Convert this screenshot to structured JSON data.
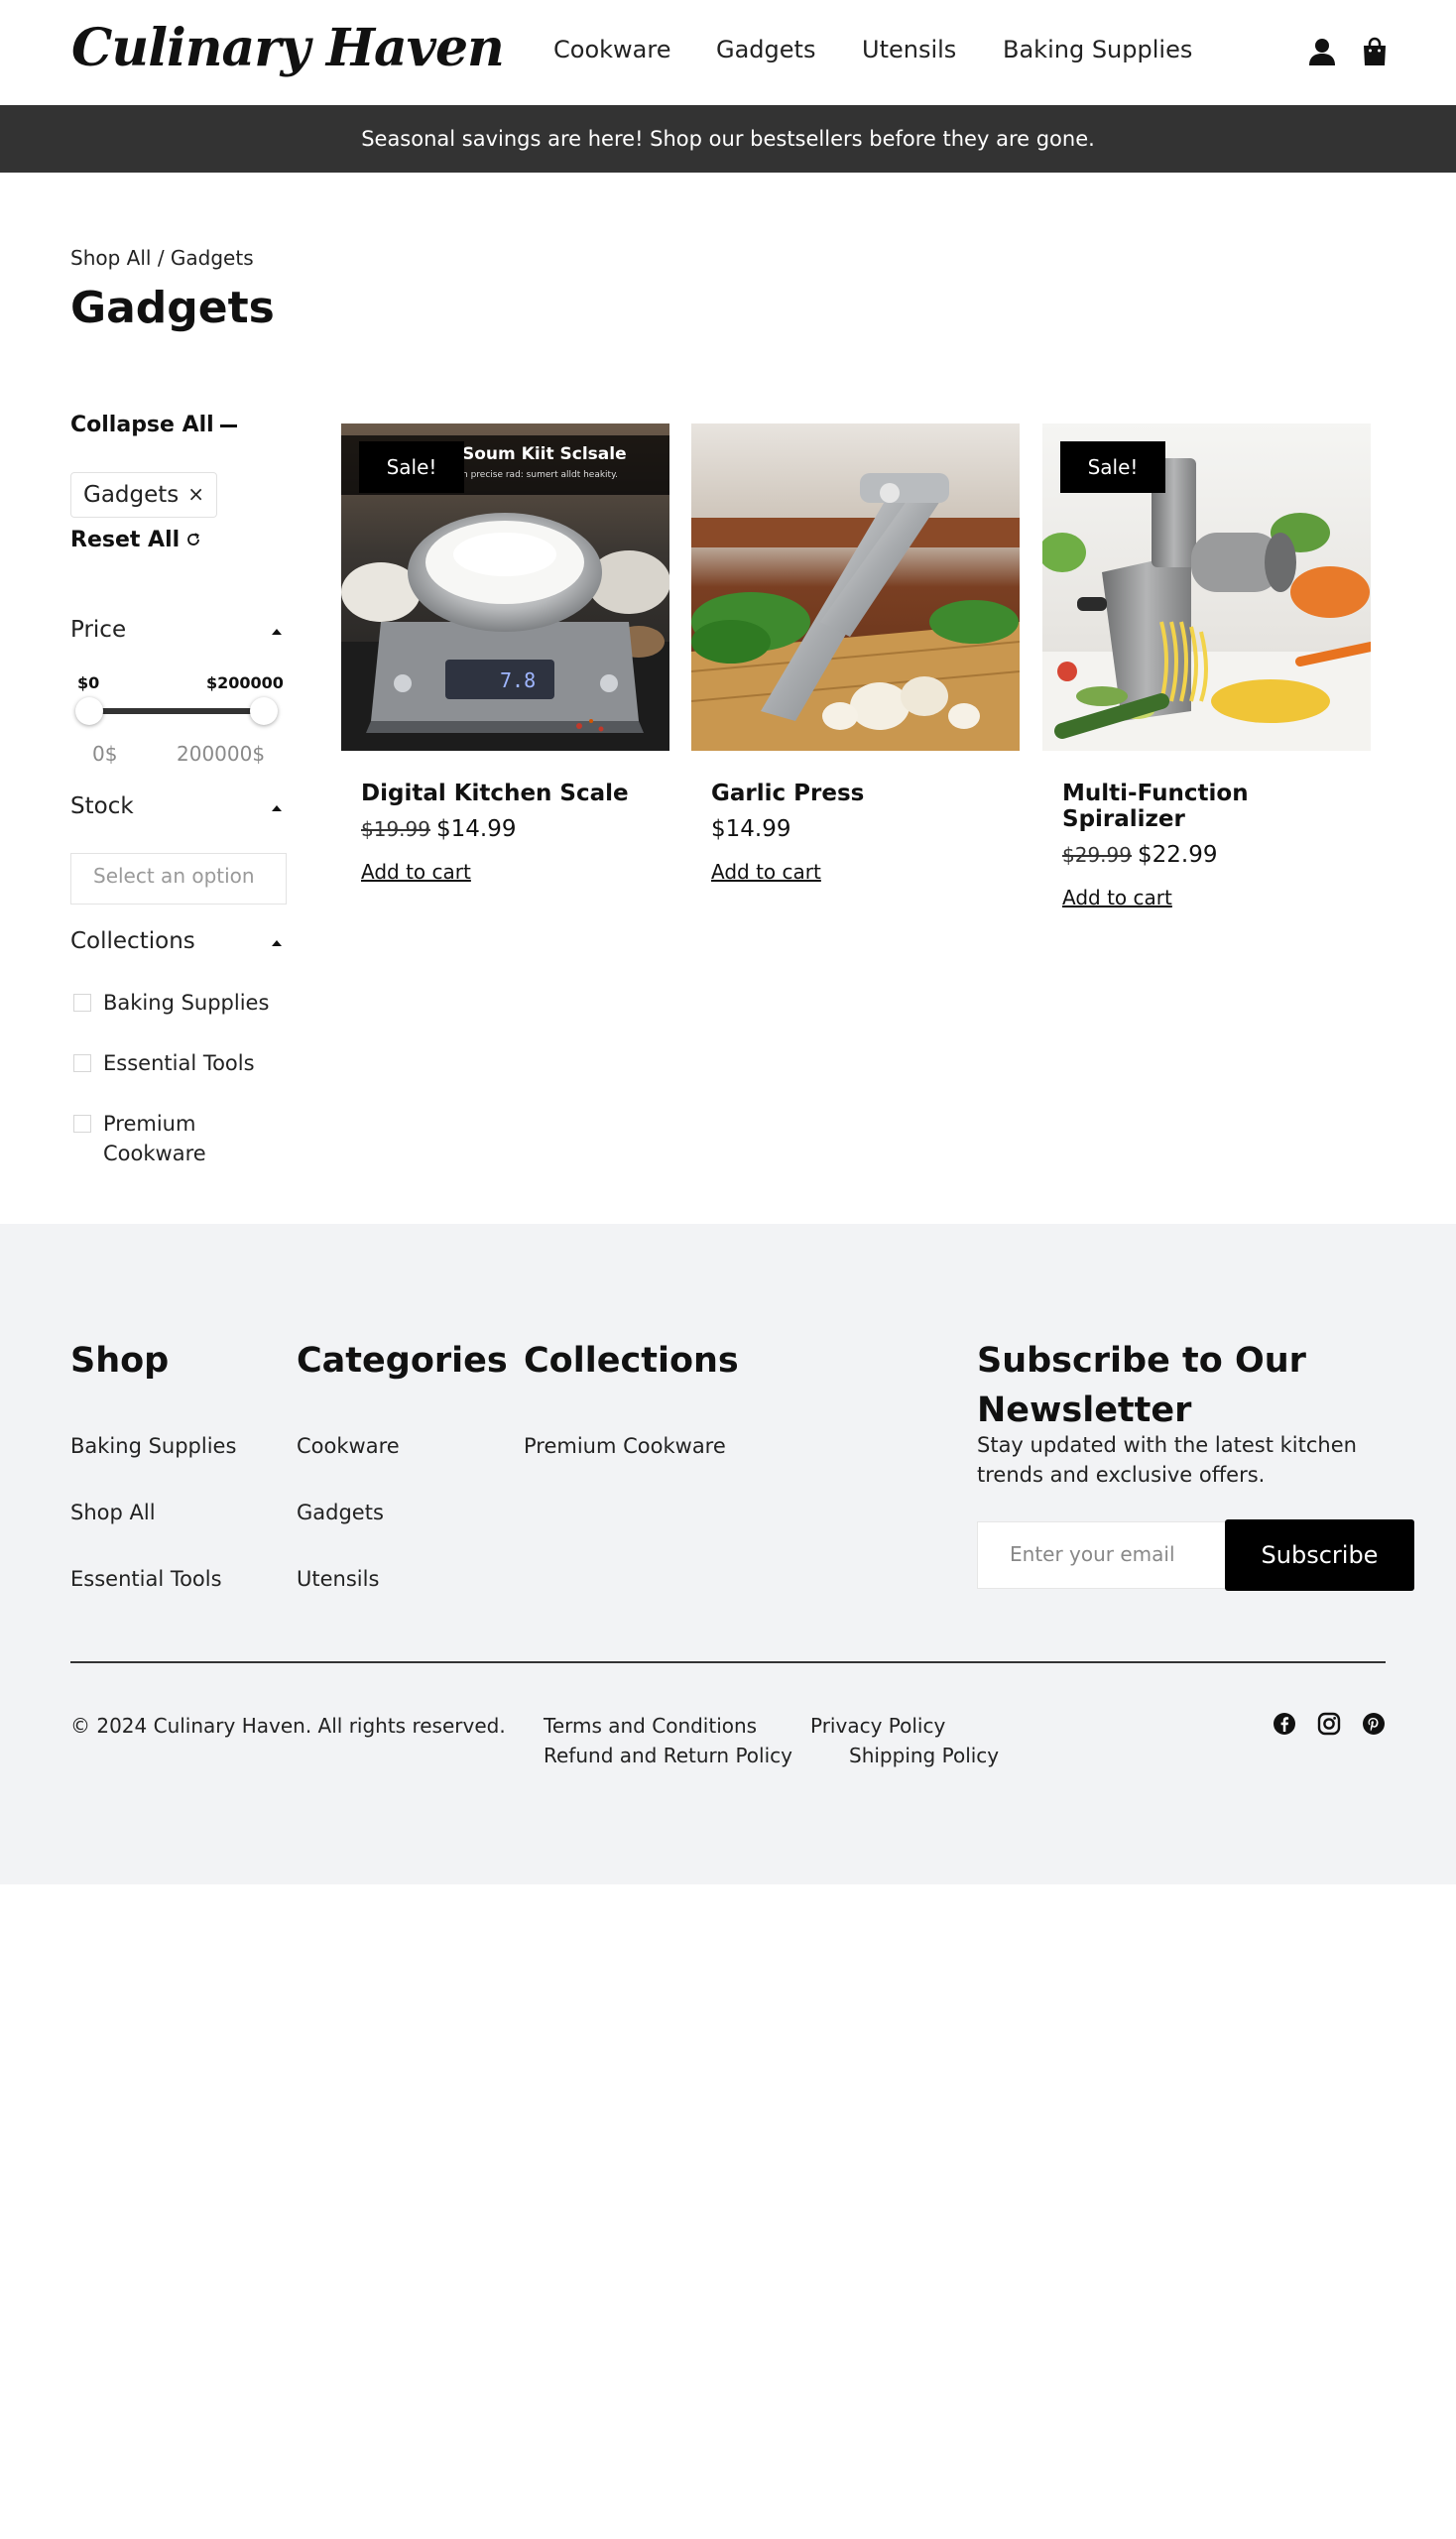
{
  "header": {
    "logo": "Culinary Haven",
    "nav": [
      "Cookware",
      "Gadgets",
      "Utensils",
      "Baking Supplies"
    ],
    "icons": [
      "account-icon",
      "shopping-bag-icon"
    ]
  },
  "announcement": "Seasonal savings are here! Shop our bestsellers before they are gone.",
  "breadcrumb": "Shop All / Gadgets",
  "page_title": "Gadgets",
  "filters": {
    "collapse_all": "Collapse All",
    "active_chip": "Gadgets",
    "chip_remove": "×",
    "reset_all": "Reset All",
    "price": {
      "title": "Price",
      "min_label": "$0",
      "max_label": "$200000",
      "range_min": "0$",
      "range_max": "200000$",
      "selected_min_fraction": 0,
      "selected_max_fraction": 1
    },
    "stock": {
      "title": "Stock",
      "placeholder": "Select an option"
    },
    "collections": {
      "title": "Collections",
      "options": [
        "Baking Supplies",
        "Essential Tools",
        "Premium Cookware"
      ]
    }
  },
  "products": [
    {
      "name": "Digital Kitchen Scale",
      "old_price": "$19.99",
      "price": "$14.99",
      "badge": "Sale!",
      "cta": "Add to cart",
      "image_text": "Soum Kiit Sclsale",
      "image_subtext": "n precise rad: sumert alldt heakity.",
      "scale_readout": "7.8"
    },
    {
      "name": "Garlic Press",
      "old_price": "",
      "price": "$14.99",
      "badge": "",
      "cta": "Add to cart"
    },
    {
      "name": "Multi-Function Spiralizer",
      "old_price": "$29.99",
      "price": "$22.99",
      "badge": "Sale!",
      "cta": "Add to cart"
    }
  ],
  "footer": {
    "shop": {
      "title": "Shop",
      "links": [
        "Baking Supplies",
        "Shop All",
        "Essential Tools"
      ]
    },
    "categories": {
      "title": "Categories",
      "links": [
        "Cookware",
        "Gadgets",
        "Utensils"
      ]
    },
    "collections": {
      "title": "Collections",
      "links": [
        "Premium Cookware"
      ]
    },
    "newsletter": {
      "title": "Subscribe to Our Newsletter",
      "text": "Stay updated with the latest kitchen trends and exclusive offers.",
      "placeholder": "Enter your email",
      "button": "Subscribe"
    },
    "copyright": "© 2024 Culinary Haven. All rights reserved.",
    "legal": [
      "Terms and Conditions",
      "Privacy Policy",
      "Refund and Return Policy",
      "Shipping Policy"
    ],
    "social": [
      "facebook-icon",
      "instagram-icon",
      "pinterest-icon"
    ]
  },
  "colors": {
    "announcement_bg": "#333333",
    "footer_bg": "#f2f3f5",
    "badge_bg": "#000000",
    "button_bg": "#000000"
  }
}
